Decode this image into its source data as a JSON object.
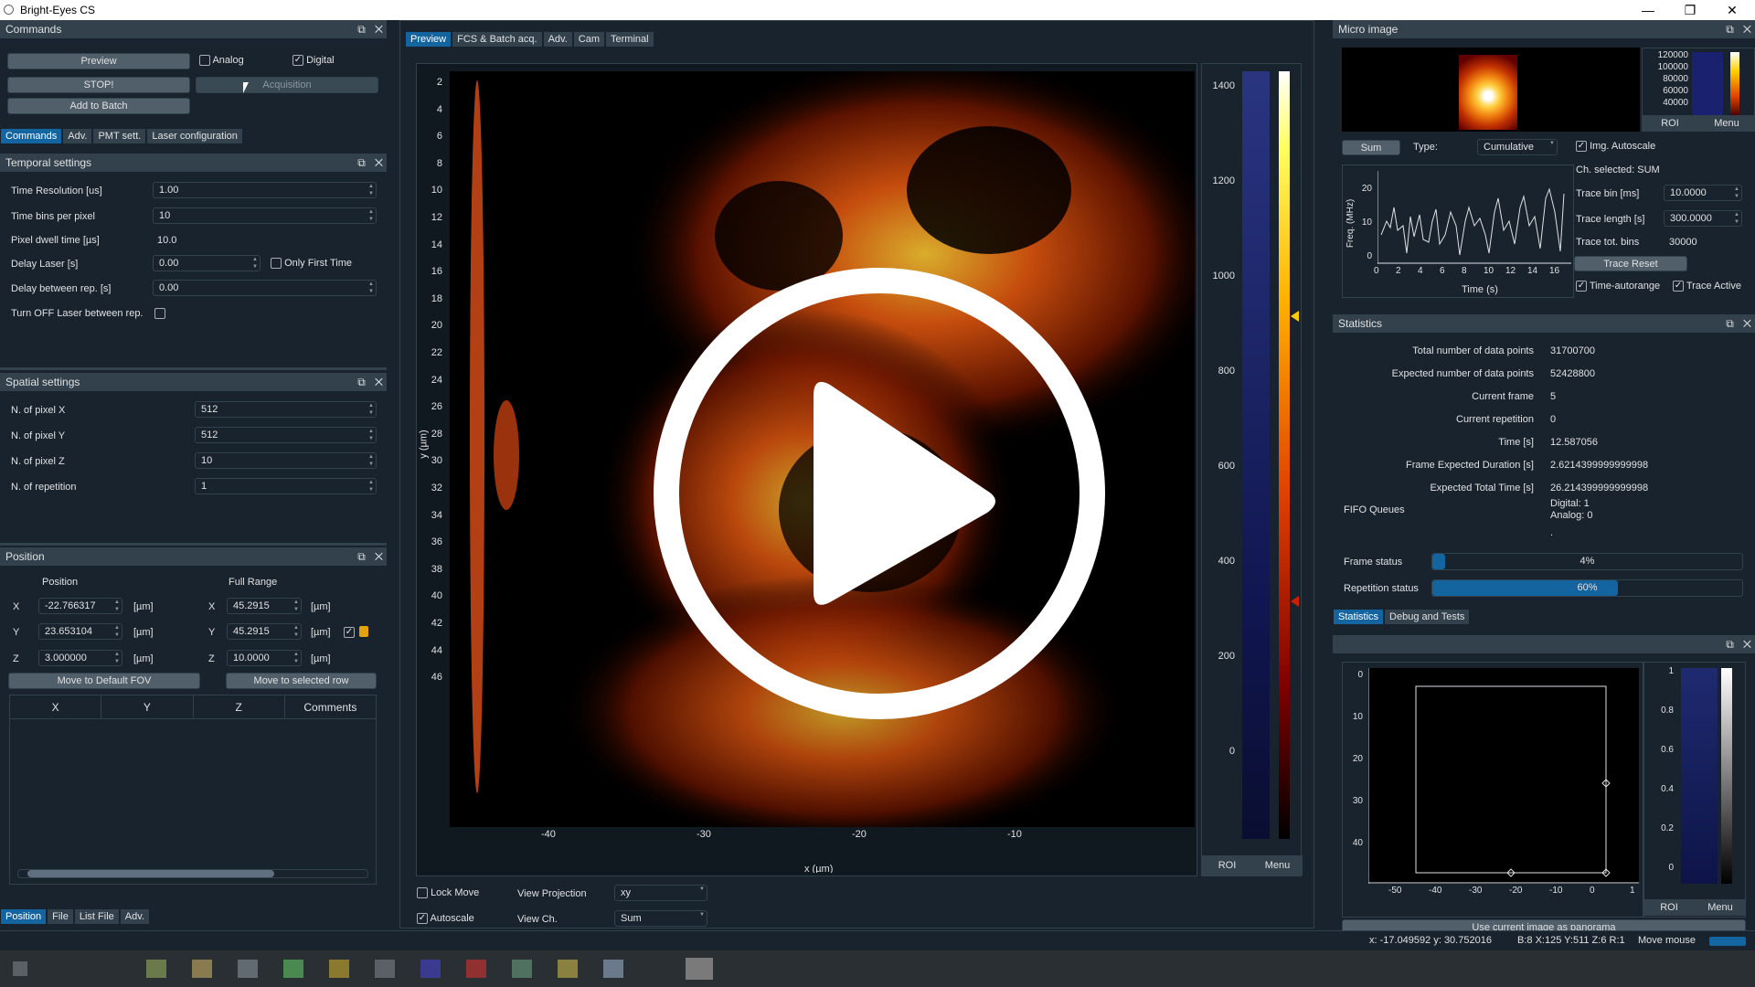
{
  "window": {
    "title": "Bright-Eyes CS",
    "controls": [
      "—",
      "❐",
      "✕"
    ]
  },
  "commands": {
    "title": "Commands",
    "preview": "Preview",
    "analog": "Analog",
    "digital": "Digital",
    "stop": "STOP!",
    "acquisition": "Acquisition",
    "add_batch": "Add to Batch",
    "tabs": [
      "Commands",
      "Adv.",
      "PMT sett.",
      "Laser configuration"
    ]
  },
  "temporal": {
    "title": "Temporal settings",
    "time_res_label": "Time Resolution [us]",
    "time_res": "1.00",
    "bins_label": "Time bins per pixel",
    "bins": "10",
    "dwell_label": "Pixel dwell time [µs]",
    "dwell": "10.0",
    "delay_label": "Delay Laser [s]",
    "delay": "0.00",
    "only_first": "Only First Time",
    "delay_rep_label": "Delay between rep. [s]",
    "delay_rep": "0.00",
    "turn_off_label": "Turn OFF Laser between rep."
  },
  "spatial": {
    "title": "Spatial settings",
    "nx_label": "N. of pixel X",
    "nx": "512",
    "ny_label": "N. of pixel Y",
    "ny": "512",
    "nz_label": "N. of pixel Z",
    "nz": "10",
    "nrep_label": "N. of repetition",
    "nrep": "1"
  },
  "position": {
    "title": "Position",
    "pos_header": "Position",
    "range_header": "Full Range",
    "x_label": "X",
    "x": "-22.766317",
    "xr": "45.2915",
    "y_label": "Y",
    "y": "23.653104",
    "yr": "45.2915",
    "z_label": "Z",
    "z": "3.000000",
    "zr": "10.0000",
    "unit": "[µm]",
    "move_default": "Move to Default FOV",
    "move_selected": "Move to selected row",
    "table_headers": [
      "X",
      "Y",
      "Z",
      "Comments"
    ],
    "bottom_tabs": [
      "Position",
      "File",
      "List File",
      "Adv."
    ]
  },
  "center": {
    "tabs": [
      "Preview",
      "FCS & Batch acq.",
      "Adv.",
      "Cam",
      "Terminal"
    ],
    "y_ticks": [
      "2",
      "4",
      "6",
      "8",
      "10",
      "12",
      "14",
      "16",
      "18",
      "20",
      "22",
      "24",
      "26",
      "28",
      "30",
      "32",
      "34",
      "36",
      "38",
      "40",
      "42",
      "44",
      "46"
    ],
    "y_label": "y (µm)",
    "x_ticks": [
      "-40",
      "-30",
      "-20",
      "-10"
    ],
    "x_label": "x (µm)",
    "cbar_ticks": [
      "1400",
      "1200",
      "1000",
      "800",
      "600",
      "400",
      "200",
      "0"
    ],
    "roi": "ROI",
    "menu": "Menu",
    "lock_move": "Lock Move",
    "autoscale": "Autoscale",
    "view_proj_label": "View Projection",
    "view_proj": "xy",
    "view_ch_label": "View Ch.",
    "view_ch": "Sum"
  },
  "micro": {
    "title": "Micro image",
    "cbar_ticks": [
      "120000",
      "100000",
      "80000",
      "60000",
      "40000"
    ],
    "roi": "ROI",
    "menu": "Menu",
    "sum": "Sum",
    "type_label": "Type:",
    "type": "Cumulative",
    "img_autoscale": "Img. Autoscale",
    "ch_selected": "Ch. selected: SUM",
    "trace_bin_label": "Trace bin [ms]",
    "trace_bin": "10.0000",
    "trace_len_label": "Trace length [s]",
    "trace_len": "300.0000",
    "trace_tot_label": "Trace tot. bins",
    "trace_tot": "30000",
    "trace_reset": "Trace Reset",
    "time_autorange": "Time-autorange",
    "trace_active": "Trace Active",
    "trace_ylabel": "Freq. (MHz)",
    "trace_xlabel": "Time (s)",
    "trace_yticks": [
      "20",
      "10",
      "0"
    ],
    "trace_xticks": [
      "0",
      "2",
      "4",
      "6",
      "8",
      "10",
      "12",
      "14",
      "16"
    ]
  },
  "statistics": {
    "title": "Statistics",
    "rows": [
      {
        "label": "Total number of data points",
        "value": "31700700"
      },
      {
        "label": "Expected number of data points",
        "value": "52428800"
      },
      {
        "label": "Current frame",
        "value": "5"
      },
      {
        "label": "Current repetition",
        "value": "0"
      },
      {
        "label": "Time [s]",
        "value": "12.587056"
      },
      {
        "label": "Frame Expected Duration [s]",
        "value": "2.6214399999999998"
      },
      {
        "label": "Expected Total Time [s]",
        "value": "26.214399999999998"
      }
    ],
    "fifo_label": "FIFO Queues",
    "fifo_digital": "Digital: 1",
    "fifo_analog": "Analog: 0",
    "dot": ".",
    "frame_status_label": "Frame status",
    "frame_status": 0.04,
    "frame_status_text": "4%",
    "rep_status_label": "Repetition status",
    "rep_status": 0.6,
    "rep_status_text": "60%",
    "tabs": [
      "Statistics",
      "Debug and Tests"
    ]
  },
  "panorama": {
    "y_ticks": [
      "0",
      "10",
      "20",
      "30",
      "40"
    ],
    "x_ticks": [
      "-50",
      "-40",
      "-30",
      "-20",
      "-10",
      "0",
      "1"
    ],
    "cbar_ticks": [
      "1",
      "0.8",
      "0.6",
      "0.4",
      "0.2",
      "0"
    ],
    "roi": "ROI",
    "menu": "Menu",
    "use_current": "Use current image as panorama"
  },
  "statusbar": {
    "coords": "x: -17.049592  y: 30.752016",
    "voxel": "B:8 X:125 Y:511 Z:6 R:1",
    "mouse": "Move mouse"
  },
  "colors": {
    "bg": "#19232d",
    "panel_title": "#32414b",
    "accent": "#1464a0",
    "button": "#505f69"
  }
}
